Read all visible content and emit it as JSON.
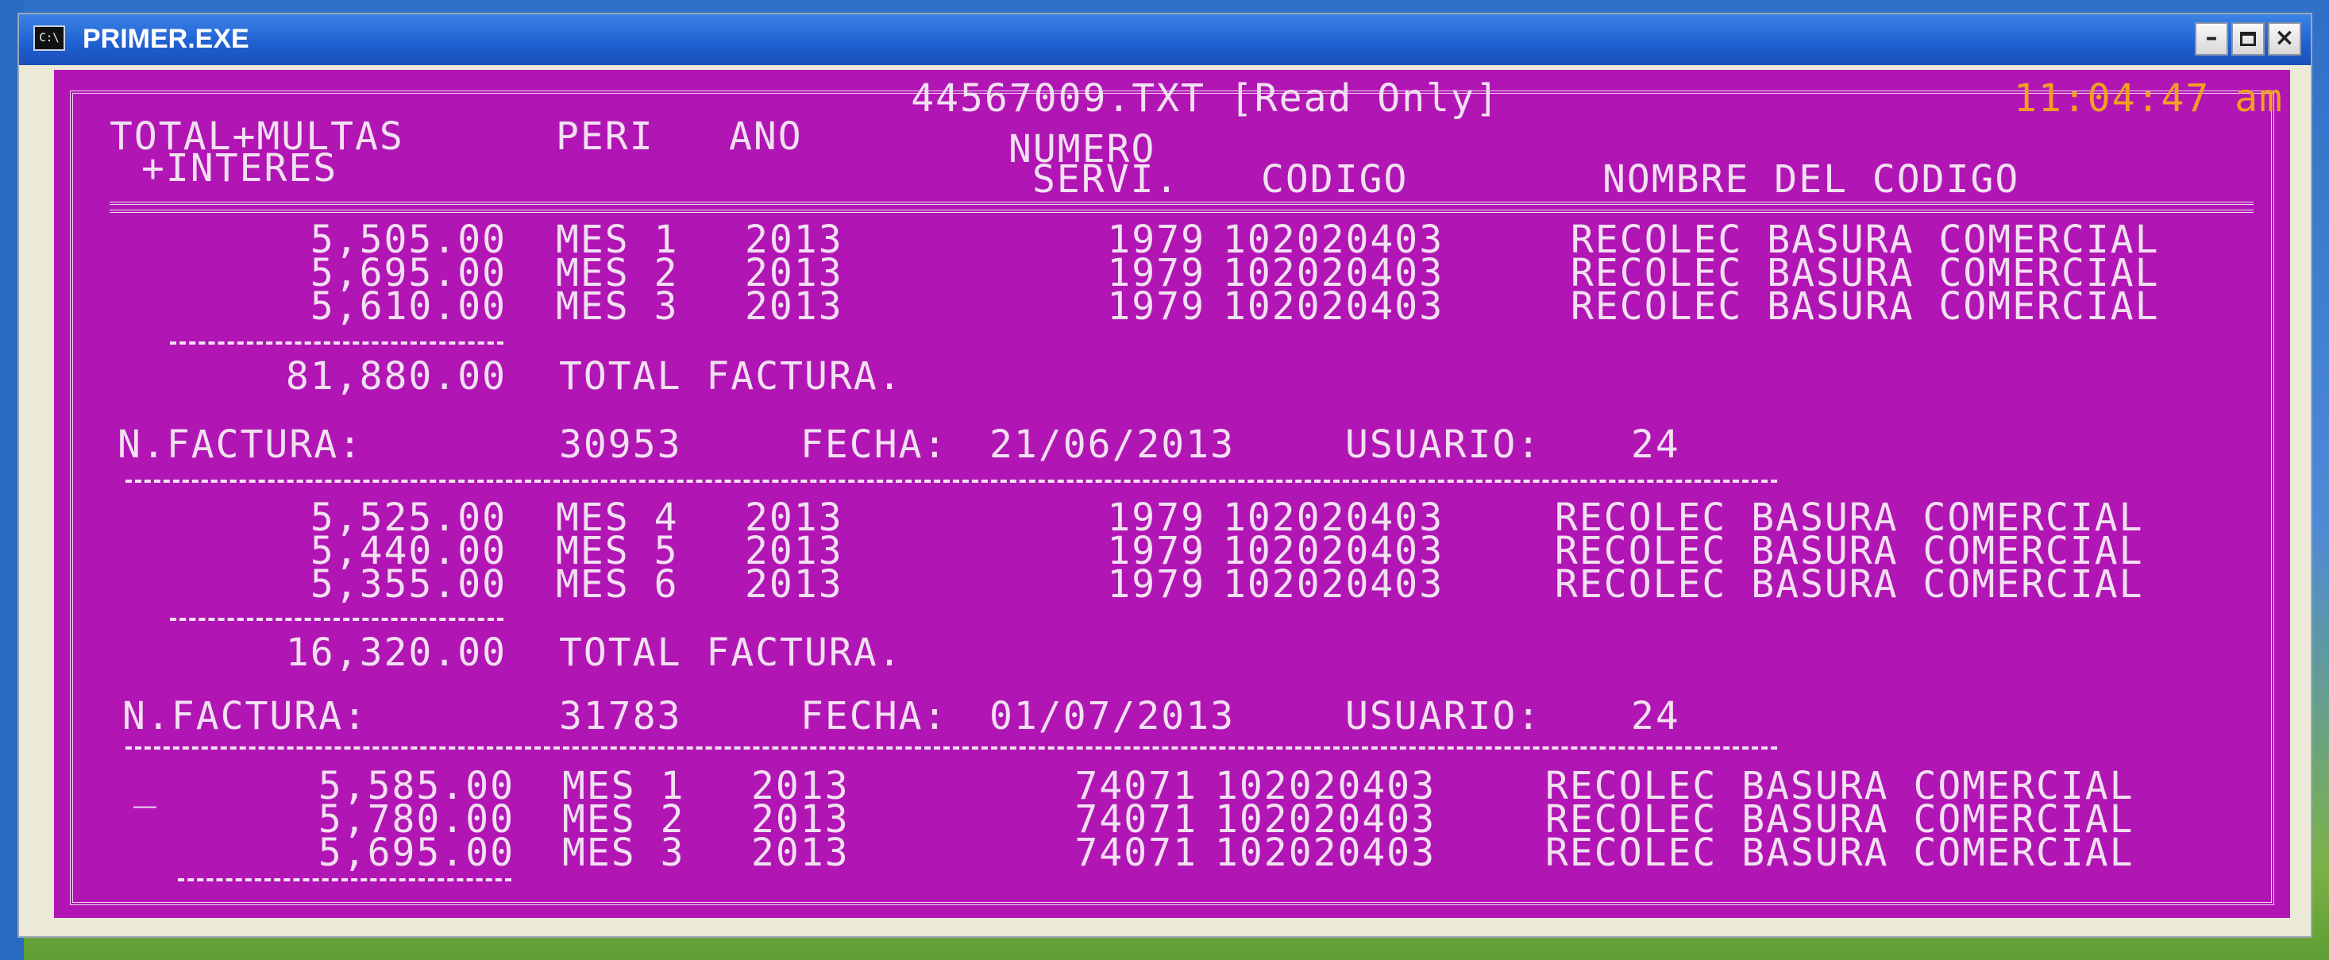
{
  "window": {
    "title": "PRIMER.EXE",
    "icon_text": "C:\\"
  },
  "header": {
    "file_title": "44567009.TXT [Read Only]",
    "clock": "11:04:47 am",
    "columns": {
      "total_line1": "TOTAL+MULTAS",
      "total_line2": "+INTERES",
      "peri": "PERI",
      "ano": "ANO",
      "numero_line1": "NUMERO",
      "numero_line2": "SERVI.",
      "codigo": "CODIGO",
      "nombre": "NOMBRE DEL CODIGO"
    }
  },
  "groups": [
    {
      "rows": [
        {
          "total": "5,505.00",
          "peri": "MES 1",
          "ano": "2013",
          "servi": "1979",
          "codigo": "102020403",
          "nombre": "RECOLEC BASURA COMERCIAL"
        },
        {
          "total": "5,695.00",
          "peri": "MES 2",
          "ano": "2013",
          "servi": "1979",
          "codigo": "102020403",
          "nombre": "RECOLEC BASURA COMERCIAL"
        },
        {
          "total": "5,610.00",
          "peri": "MES 3",
          "ano": "2013",
          "servi": "1979",
          "codigo": "102020403",
          "nombre": "RECOLEC BASURA COMERCIAL"
        }
      ],
      "total_factura": "81,880.00",
      "total_label": "TOTAL FACTURA.",
      "factura_label": "N.FACTURA:",
      "factura": "30953",
      "fecha_label": "FECHA:",
      "fecha": "21/06/2013",
      "usuario_label": "USUARIO:",
      "usuario": "24"
    },
    {
      "rows": [
        {
          "total": "5,525.00",
          "peri": "MES 4",
          "ano": "2013",
          "servi": "1979",
          "codigo": "102020403",
          "nombre": "RECOLEC BASURA COMERCIAL"
        },
        {
          "total": "5,440.00",
          "peri": "MES 5",
          "ano": "2013",
          "servi": "1979",
          "codigo": "102020403",
          "nombre": "RECOLEC BASURA COMERCIAL"
        },
        {
          "total": "5,355.00",
          "peri": "MES 6",
          "ano": "2013",
          "servi": "1979",
          "codigo": "102020403",
          "nombre": "RECOLEC BASURA COMERCIAL"
        }
      ],
      "total_factura": "16,320.00",
      "total_label": "TOTAL FACTURA.",
      "factura_label": "N.FACTURA:",
      "factura": "31783",
      "fecha_label": "FECHA:",
      "fecha": "01/07/2013",
      "usuario_label": "USUARIO:",
      "usuario": "24"
    },
    {
      "cursor": "_",
      "rows": [
        {
          "total": "5,585.00",
          "peri": "MES 1",
          "ano": "2013",
          "servi": "74071",
          "codigo": "102020403",
          "nombre": "RECOLEC BASURA COMERCIAL"
        },
        {
          "total": "5,780.00",
          "peri": "MES 2",
          "ano": "2013",
          "servi": "74071",
          "codigo": "102020403",
          "nombre": "RECOLEC BASURA COMERCIAL"
        },
        {
          "total": "5,695.00",
          "peri": "MES 3",
          "ano": "2013",
          "servi": "74071",
          "codigo": "102020403",
          "nombre": "RECOLEC BASURA COMERCIAL"
        }
      ]
    }
  ]
}
